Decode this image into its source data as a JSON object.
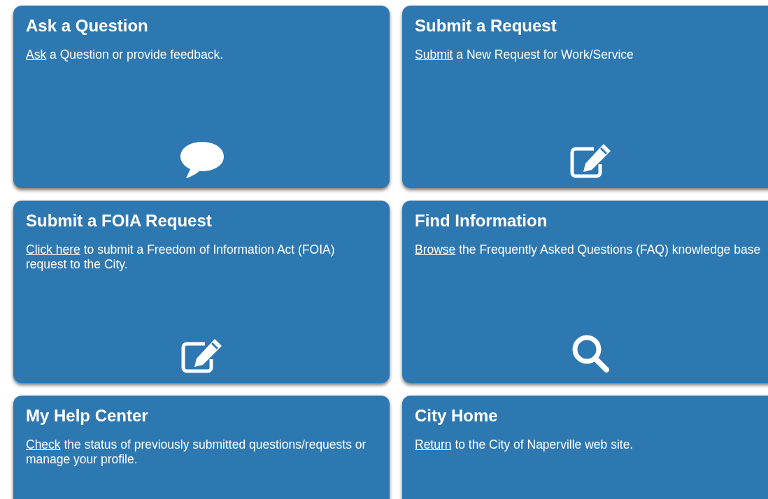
{
  "cards": [
    {
      "title": "Ask a Question",
      "link": "Ask",
      "text": " a Question or provide feedback.",
      "kind": "chat"
    },
    {
      "title": "Submit a Request",
      "link": "Submit",
      "text": " a New Request for Work/Service",
      "kind": "edit"
    },
    {
      "title": "Submit a FOIA Request",
      "link": "Click here",
      "text": " to submit a Freedom of Information Act (FOIA) request to the City.",
      "kind": "edit"
    },
    {
      "title": "Find Information",
      "link": "Browse",
      "text": " the Frequently Asked Questions (FAQ) knowledge base",
      "kind": "search"
    },
    {
      "title": "My Help Center",
      "link": "Check",
      "text": " the status of previously submitted questions/requests or manage your profile."
    },
    {
      "title": "City Home",
      "link": "Return",
      "text": " to the City of Naperville web site."
    }
  ]
}
